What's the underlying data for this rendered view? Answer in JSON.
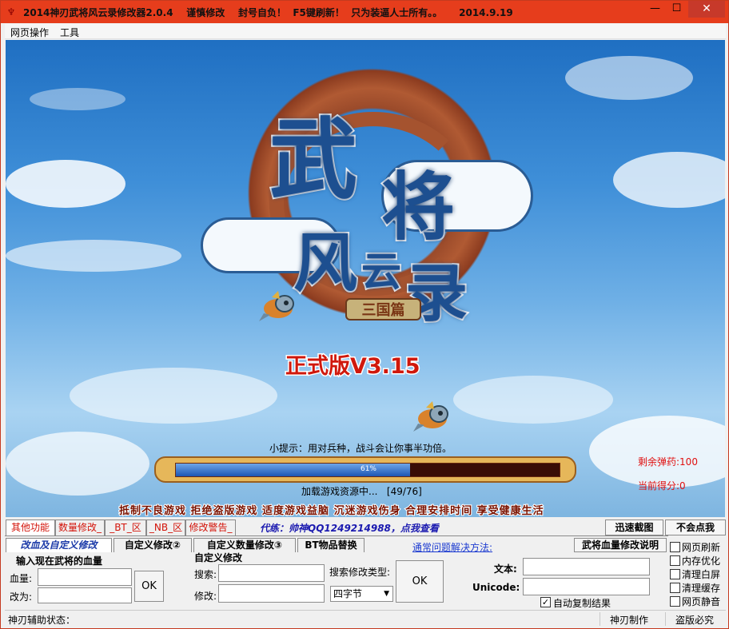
{
  "window": {
    "title": "2014神刃武将风云录修改器2.0.4    谨慎修改    封号自负！  F5键刷新！  只为装逼人士所有。。     2014.9.19",
    "minimize": "—",
    "maximize": "☐",
    "close": "✕"
  },
  "menu": [
    "网页操作",
    "工具"
  ],
  "game": {
    "logo_chars": [
      "武",
      "将",
      "风",
      "云",
      "录"
    ],
    "subtitle": "三国篇",
    "version": "正式版V3.15",
    "tip": "小提示：用对兵种，战斗会让你事半功倍。",
    "progress_percent": 61,
    "progress_label": "61%",
    "loading_text": "加载游戏资源中...   [49/76]",
    "slogan": "抵制不良游戏  拒绝盗版游戏  适度游戏益脑  沉迷游戏伤身  合理安排时间  享受健康生活",
    "ammo": "剩余弹药:100",
    "score": "当前得分:0"
  },
  "main_tabs": [
    "其他功能",
    "数量修改_",
    "_BT_区",
    "_NB_区",
    "修改警告_"
  ],
  "ad_text": "代练：帅神QQ1249214988，点我查看",
  "right_buttons": {
    "screenshot": "迅速截图",
    "no_click": "不会点我"
  },
  "sub_tabs": [
    "改血及自定义修改",
    "自定义修改②",
    "自定义数量修改③",
    "BT物品替换"
  ],
  "faq_link": "通常问题解决方法:",
  "blood_help_button": "武将血量修改说明",
  "blood_group": {
    "title": "输入现在武将的血量",
    "hp_label": "血量:",
    "change_label": "改为:",
    "ok": "OK"
  },
  "custom_group": {
    "title": "自定义修改",
    "search_label": "搜索:",
    "change_label": "修改:",
    "type_label": "搜索修改类型:",
    "type_value": "四字节",
    "ok": "OK"
  },
  "text_group": {
    "text_label": "文本:",
    "unicode_label": "Unicode:",
    "auto_copy": "自动复制结果",
    "auto_copy_checked": true
  },
  "side_options": [
    {
      "label": "网页刷新",
      "checked": false
    },
    {
      "label": "内存优化",
      "checked": false
    },
    {
      "label": "清理白屏",
      "checked": false
    },
    {
      "label": "清理缓存",
      "checked": false
    },
    {
      "label": "网页静音",
      "checked": false
    }
  ],
  "status": {
    "left": "神刃辅助状态：",
    "maker": "神刃制作",
    "piracy": "盗版必究"
  },
  "colors": {
    "titlebar": "#e63d1c",
    "accent_red": "#e01010",
    "link_blue": "#1b3ad0"
  }
}
